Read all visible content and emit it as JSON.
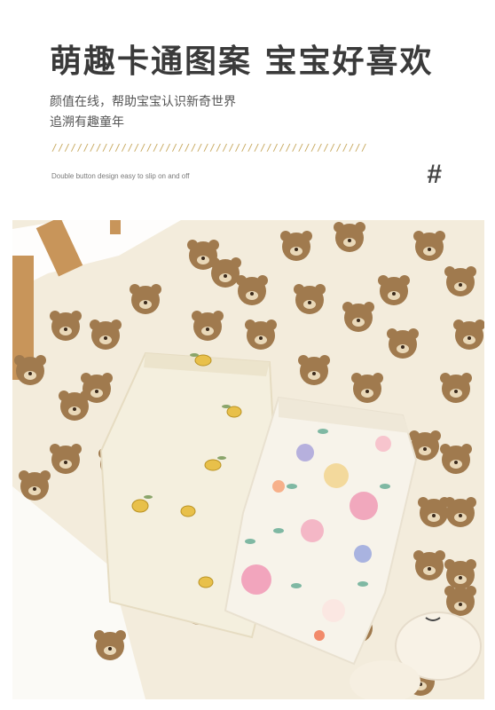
{
  "header": {
    "title": "萌趣卡通图案 宝宝好喜欢",
    "desc_line1": "颜值在线，帮助宝宝认识新奇世界",
    "desc_line2": "追溯有趣童年",
    "dashes": "//////////////////////////////////////////////////",
    "caption": "Double button design easy to slip on and off",
    "hash": "#"
  },
  "photo": {
    "colors": {
      "background_blanket": "#f3ecdc",
      "bear_face": "#a07a4e",
      "lemon_blanket": "#f4efde",
      "floral_blanket": "#f7f3ea",
      "crib_wood": "#c8955a"
    }
  }
}
